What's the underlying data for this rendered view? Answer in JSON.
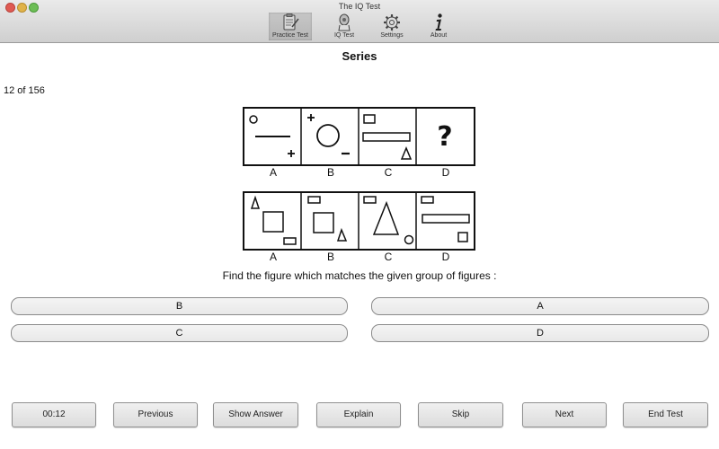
{
  "window": {
    "title": "The IQ Test"
  },
  "toolbar": {
    "items": [
      {
        "label": "Practice Test",
        "icon": "clipboard-pencil-icon",
        "selected": true
      },
      {
        "label": "IQ Test",
        "icon": "brain-head-icon",
        "selected": false
      },
      {
        "label": "Settings",
        "icon": "gear-icon",
        "selected": false
      },
      {
        "label": "About",
        "icon": "info-icon",
        "selected": false
      }
    ]
  },
  "main": {
    "section_title": "Series",
    "counter": "12 of 156",
    "problem_figure": {
      "labels": [
        "A",
        "B",
        "C",
        "D"
      ],
      "cells": [
        {
          "shapes": [
            "small circle top-left",
            "horizontal line center",
            "plus bottom-right"
          ]
        },
        {
          "shapes": [
            "plus top-left",
            "large circle center",
            "minus bottom-right"
          ]
        },
        {
          "shapes": [
            "small square top-left",
            "long rectangle center",
            "triangle bottom-right"
          ]
        },
        {
          "shapes": [
            "question mark"
          ]
        }
      ],
      "question_mark": "?"
    },
    "answer_figure": {
      "labels": [
        "A",
        "B",
        "C",
        "D"
      ],
      "cells": [
        {
          "shapes": [
            "triangle top-left",
            "square center",
            "small rectangle bottom-right"
          ]
        },
        {
          "shapes": [
            "small rectangle top-left",
            "square center",
            "triangle bottom-right"
          ]
        },
        {
          "shapes": [
            "small rectangle top-left",
            "large triangle center",
            "small circle bottom-right"
          ]
        },
        {
          "shapes": [
            "small rectangle top-left",
            "long rectangle center",
            "small square bottom-right"
          ]
        }
      ]
    },
    "question": "Find the figure which matches the given group of figures :",
    "answers": [
      "B",
      "A",
      "C",
      "D"
    ]
  },
  "bottom_bar": {
    "timer": "00:12",
    "previous": "Previous",
    "show_answer": "Show Answer",
    "explain": "Explain",
    "skip": "Skip",
    "next": "Next",
    "end_test": "End Test"
  }
}
